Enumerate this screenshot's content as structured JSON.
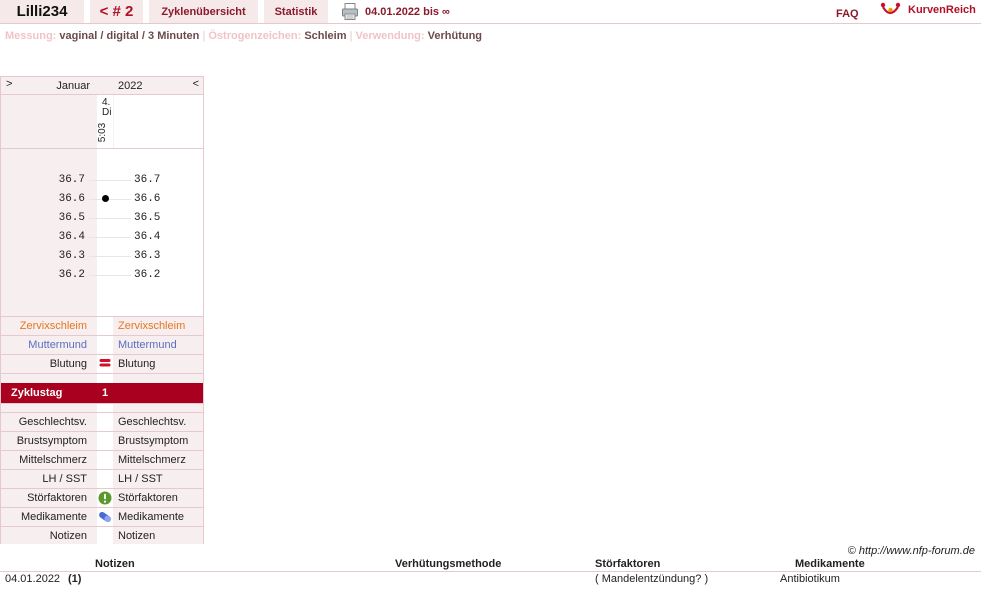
{
  "header": {
    "user_tab": "Lilli234",
    "cycle_tab": "< # 2",
    "overview_tab": "Zyklenübersicht",
    "stats_tab": "Statistik",
    "date_range": "04.01.2022 bis ∞",
    "faq": "FAQ",
    "brand": "KurvenReich",
    "print_icon": "printer-icon",
    "logo_icon": "kurvenreich-logo-icon"
  },
  "info": {
    "measurement_label": "Messung:",
    "measurement_value": "vaginal / digital / 3 Minuten",
    "estrogen_label": "Östrogenzeichen:",
    "estrogen_value": "Schleim",
    "usage_label": "Verwendung:",
    "usage_value": "Verhütung",
    "separator": "|"
  },
  "chart": {
    "nav_next": ">",
    "nav_prev": "<",
    "month": "Januar",
    "year": "2022",
    "day": {
      "num": "4.",
      "weekday": "Di",
      "time": "5:03",
      "cycle_day": "1"
    },
    "temp_labels": [
      "36.7",
      "36.6",
      "36.5",
      "36.4",
      "36.3",
      "36.2"
    ],
    "measured_temp": 36.6,
    "rows": {
      "cervix_mucus": "Zervixschleim",
      "cervix": "Muttermund",
      "bleeding": "Blutung",
      "cycle_day": "Zyklustag",
      "intercourse": "Geschlechtsv.",
      "breast": "Brustsymptom",
      "midpain": "Mittelschmerz",
      "lh": "LH / SST",
      "disturbance": "Störfaktoren",
      "medication": "Medikamente",
      "notes": "Notizen"
    },
    "colors": {
      "mucus": "#e8761e",
      "cervix": "#5a6fc0",
      "accent": "#a8001e",
      "grid": "#e6c9cc"
    },
    "icons": {
      "bleeding": "bleeding-icon",
      "disturbance": "warning-icon",
      "medication": "pill-icon"
    }
  },
  "copyright": "© http://www.nfp-forum.de",
  "notes_table": {
    "headers": {
      "notes": "Notizen",
      "contraception": "Verhütungsmethode",
      "disturbance": "Störfaktoren",
      "medication": "Medikamente"
    },
    "rows": [
      {
        "date": "04.01.2022",
        "ref": "(1)",
        "disturbance": "( Mandelentzündung? )",
        "medication": "Antibiotikum"
      }
    ]
  }
}
